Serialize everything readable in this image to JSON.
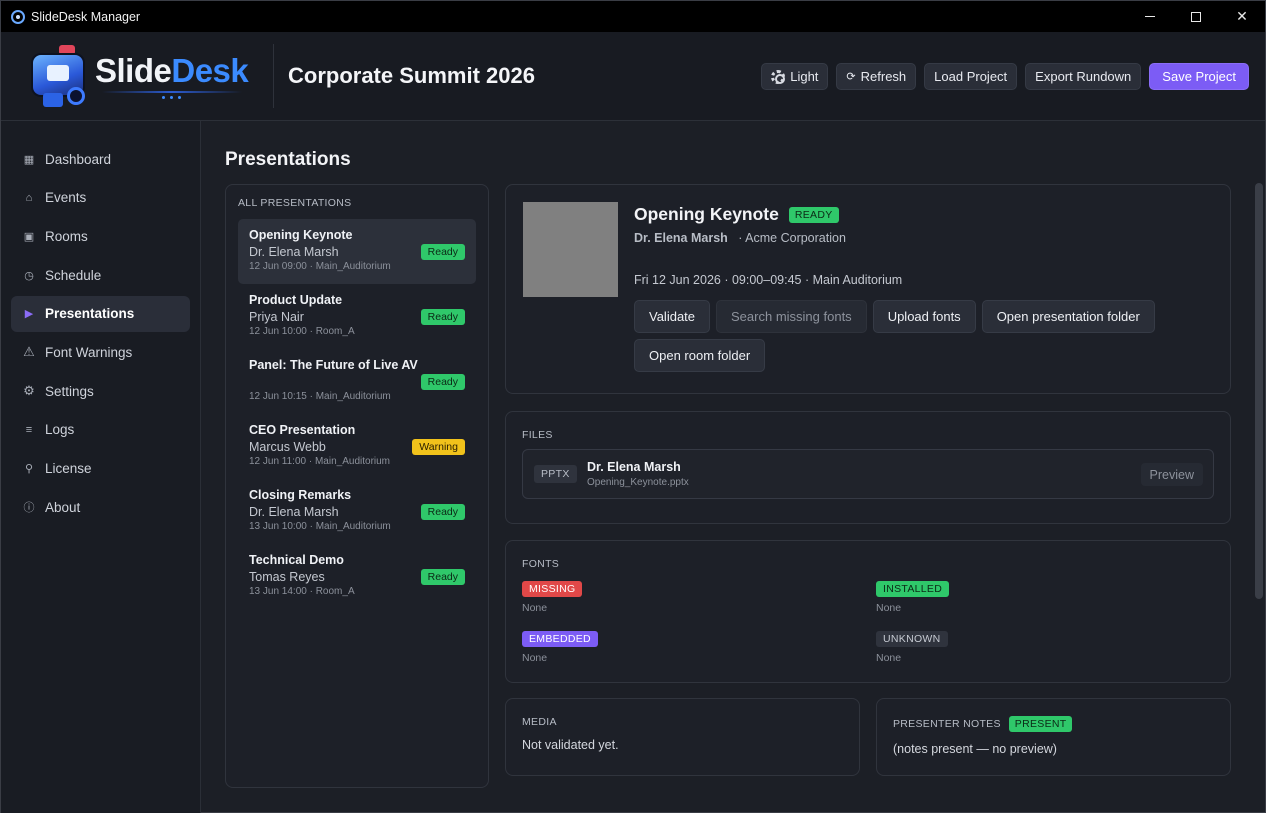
{
  "window": {
    "title": "SlideDesk Manager"
  },
  "brand": {
    "part1": "Slide",
    "part2": "Desk"
  },
  "project": {
    "title": "Corporate Summit 2026"
  },
  "header_actions": {
    "light": "Light",
    "refresh": "Refresh",
    "load": "Load Project",
    "export": "Export Rundown",
    "save": "Save Project"
  },
  "sidebar": {
    "items": [
      {
        "label": "Dashboard",
        "icon": "grid-icon"
      },
      {
        "label": "Events",
        "icon": "home-icon"
      },
      {
        "label": "Rooms",
        "icon": "square-icon"
      },
      {
        "label": "Schedule",
        "icon": "clock-icon"
      },
      {
        "label": "Presentations",
        "icon": "play-icon",
        "active": true
      },
      {
        "label": "Font Warnings",
        "icon": "warning-icon"
      },
      {
        "label": "Settings",
        "icon": "gear-icon"
      },
      {
        "label": "Logs",
        "icon": "list-icon"
      },
      {
        "label": "License",
        "icon": "key-icon"
      },
      {
        "label": "About",
        "icon": "info-icon"
      }
    ]
  },
  "page": {
    "title": "Presentations"
  },
  "list": {
    "label": "ALL PRESENTATIONS",
    "items": [
      {
        "title": "Opening Keynote",
        "person": "Dr. Elena Marsh",
        "meta": "12 Jun 09:00 · Main_Auditorium",
        "status": "Ready"
      },
      {
        "title": "Product Update",
        "person": "Priya Nair",
        "meta": "12 Jun 10:00 · Room_A",
        "status": "Ready"
      },
      {
        "title": "Panel: The Future of Live AV",
        "person": "",
        "meta": "12 Jun 10:15 · Main_Auditorium",
        "status": "Ready"
      },
      {
        "title": "CEO Presentation",
        "person": "Marcus Webb",
        "meta": "12 Jun 11:00 · Main_Auditorium",
        "status": "Warning"
      },
      {
        "title": "Closing Remarks",
        "person": "Dr. Elena Marsh",
        "meta": "13 Jun 10:00 · Main_Auditorium",
        "status": "Ready"
      },
      {
        "title": "Technical Demo",
        "person": "Tomas Reyes",
        "meta": "13 Jun 14:00 · Room_A",
        "status": "Ready"
      }
    ]
  },
  "detail": {
    "title": "Opening Keynote",
    "status": "READY",
    "presenter": "Dr. Elena Marsh",
    "company": "· Acme Corporation",
    "when": "Fri 12 Jun 2026 · 09:00–09:45 · Main Auditorium",
    "actions": {
      "validate": "Validate",
      "search_fonts": "Search missing fonts",
      "upload_fonts": "Upload fonts",
      "open_pres_folder": "Open presentation folder",
      "open_room_folder": "Open room folder"
    }
  },
  "files": {
    "label": "FILES",
    "items": [
      {
        "type": "PPTX",
        "name": "Dr. Elena Marsh",
        "path": "Opening_Keynote.pptx",
        "action": "Preview"
      }
    ]
  },
  "fonts": {
    "label": "FONTS",
    "missing": {
      "tag": "MISSING",
      "value": "None"
    },
    "installed": {
      "tag": "INSTALLED",
      "value": "None"
    },
    "embedded": {
      "tag": "EMBEDDED",
      "value": "None"
    },
    "unknown": {
      "tag": "UNKNOWN",
      "value": "None"
    }
  },
  "media": {
    "label": "MEDIA",
    "text": "Not validated yet."
  },
  "notes": {
    "label": "PRESENTER NOTES",
    "status": "PRESENT",
    "text": "(notes present — no preview)"
  },
  "colors": {
    "accent": "#7c5cf5",
    "ready": "#2fc86a",
    "warning": "#f1c21b",
    "missing": "#e04848"
  }
}
